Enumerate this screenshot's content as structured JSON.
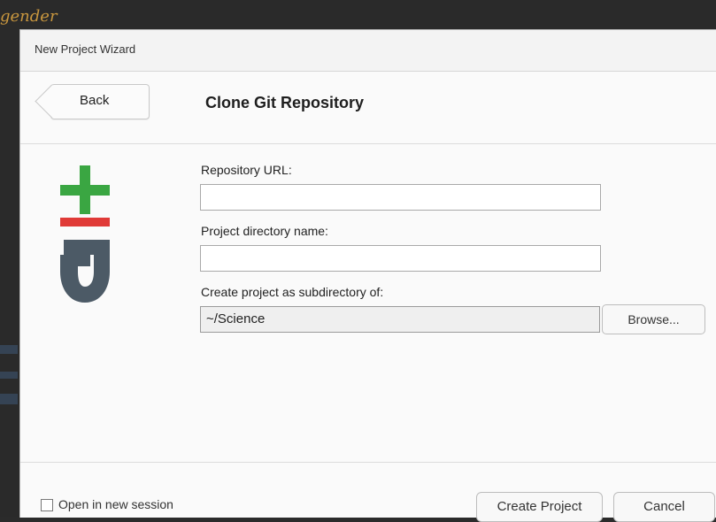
{
  "background": {
    "word": "gender"
  },
  "dialog": {
    "window_title": "New Project Wizard",
    "back_label": "Back",
    "page_title": "Clone Git Repository",
    "fields": {
      "repo_url_label": "Repository URL:",
      "repo_url_value": "",
      "project_dir_label": "Project directory name:",
      "project_dir_value": "",
      "subdir_label": "Create project as subdirectory of:",
      "subdir_value": "~/Science",
      "browse_label": "Browse..."
    },
    "footer": {
      "open_new_session_label": "Open in new session",
      "open_new_session_checked": false,
      "create_label": "Create Project",
      "cancel_label": "Cancel"
    },
    "git_logo_colors": {
      "plus": "#3aa642",
      "minus": "#e03a37",
      "g": "#4c5a66"
    }
  }
}
